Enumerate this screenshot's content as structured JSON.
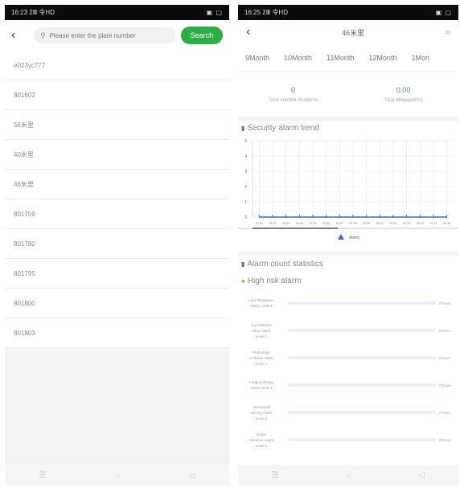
{
  "left": {
    "status_time": "16:23 2Ⅲ 令HD",
    "status_right": "▣ ▢",
    "search_placeholder": "Please enter the plate number",
    "search_button": "Search",
    "plates": [
      "e023yc777",
      "801602",
      "56米里",
      "40米里",
      "46米里",
      "801759",
      "801780",
      "801795",
      "801800",
      "801803"
    ]
  },
  "right": {
    "status_time": "16:25 2Ⅲ 令HD",
    "status_right": "▣ ▢",
    "title": "46米里",
    "months": [
      "9Month",
      "10Month",
      "11Month",
      "12Month",
      "1Mon"
    ],
    "total_alarms_value": "0",
    "total_alarms_label": "Total number of alarms",
    "total_mileage_value": "0.00",
    "total_mileage_label": "Total Mileage(km)",
    "trend_title": "Security alarm trend",
    "count_title": "Alarm count statistics",
    "high_risk_title": "High risk alarm",
    "legend_label": "Alarm",
    "risk_items": [
      {
        "label_lines": [
          "Lane Departure",
          "Alarm Level 1"
        ],
        "value": "0Times"
      },
      {
        "label_lines": [
          "Car Distance",
          "Near Alarm",
          "Level 1"
        ],
        "value": "0Times"
      },
      {
        "label_lines": [
          "Pedestrian",
          "Collision Alarm",
          "Level 1"
        ],
        "value": "0Times"
      },
      {
        "label_lines": [
          "Fatigue driving",
          "Alarm Level 1"
        ],
        "value": "0Times"
      },
      {
        "label_lines": [
          "Distracted",
          "Driving Alarm",
          "Level 1"
        ],
        "value": "0Times"
      },
      {
        "label_lines": [
          "Driver",
          "Absence Alarm",
          "Level 1"
        ],
        "value": "0Times"
      }
    ]
  },
  "chart_data": {
    "type": "line",
    "title": "Security alarm trend",
    "ylim": [
      0,
      5
    ],
    "y_ticks": [
      "5",
      "4",
      "3",
      "2",
      "1",
      "0"
    ],
    "x": [
      "02-01",
      "02-02",
      "02-03",
      "02-04",
      "02-05",
      "02-06",
      "02-07",
      "02-08",
      "02-09",
      "02-10",
      "02-11",
      "02-12",
      "02-13",
      "02-14",
      "02-15"
    ],
    "series": [
      {
        "name": "Alarm",
        "values": [
          0,
          0,
          0,
          0,
          0,
          0,
          0,
          0,
          0,
          0,
          0,
          0,
          0,
          0,
          0
        ]
      }
    ],
    "grid": true,
    "legend": "bottom",
    "colors": {
      "line": "#3b6fc4",
      "grid": "#e6e6e6"
    }
  }
}
